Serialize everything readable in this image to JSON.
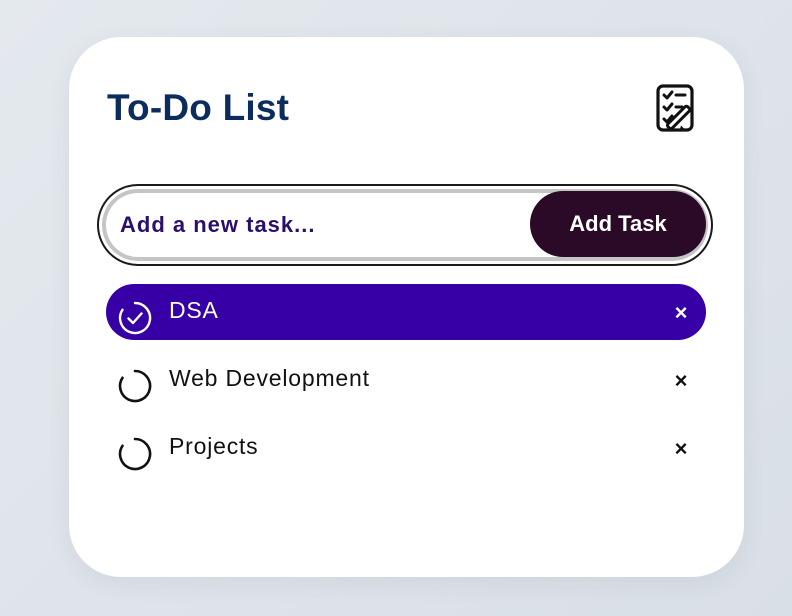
{
  "app": {
    "title": "To-Do List",
    "header_icon": "checklist-pencil-icon"
  },
  "input": {
    "placeholder": "Add a new task...",
    "value": ""
  },
  "add_button": {
    "label": "Add Task"
  },
  "tasks": [
    {
      "label": "DSA",
      "completed": true,
      "check_icon": "check-circle-icon",
      "remove_label": "×"
    },
    {
      "label": "Web Development",
      "completed": false,
      "check_icon": "empty-circle-icon",
      "remove_label": "×"
    },
    {
      "label": "Projects",
      "completed": false,
      "check_icon": "empty-circle-icon",
      "remove_label": "×"
    }
  ],
  "colors": {
    "title": "#0d2c5e",
    "accent_completed": "#3600a6",
    "button_bg": "#2a0a26",
    "placeholder_text": "#2a0f6b"
  }
}
